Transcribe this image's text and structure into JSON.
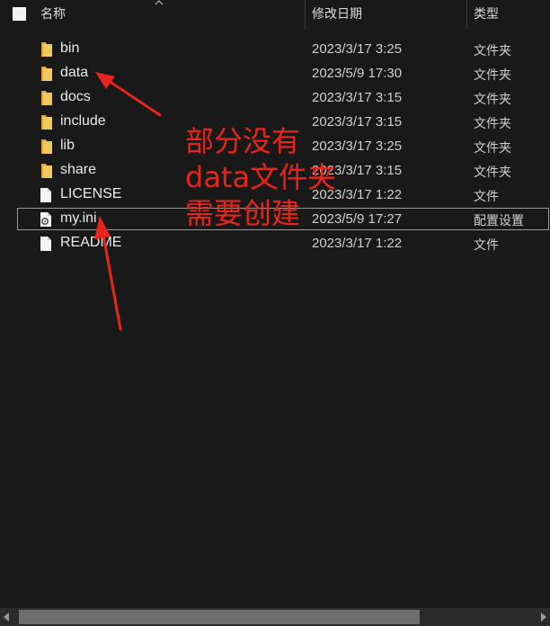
{
  "header": {
    "name_label": "名称",
    "date_label": "修改日期",
    "type_label": "类型"
  },
  "files": [
    {
      "name": "bin",
      "date": "2023/3/17 3:25",
      "type": "文件夹",
      "icon": "folder-icon"
    },
    {
      "name": "data",
      "date": "2023/5/9 17:30",
      "type": "文件夹",
      "icon": "folder-icon"
    },
    {
      "name": "docs",
      "date": "2023/3/17 3:15",
      "type": "文件夹",
      "icon": "folder-icon"
    },
    {
      "name": "include",
      "date": "2023/3/17 3:15",
      "type": "文件夹",
      "icon": "folder-icon"
    },
    {
      "name": "lib",
      "date": "2023/3/17 3:25",
      "type": "文件夹",
      "icon": "folder-icon"
    },
    {
      "name": "share",
      "date": "2023/3/17 3:15",
      "type": "文件夹",
      "icon": "folder-icon"
    },
    {
      "name": "LICENSE",
      "date": "2023/3/17 1:22",
      "type": "文件",
      "icon": "file-icon"
    },
    {
      "name": "my.ini",
      "date": "2023/5/9 17:27",
      "type": "配置设置",
      "icon": "settings-file-icon"
    },
    {
      "name": "README",
      "date": "2023/3/17 1:22",
      "type": "文件",
      "icon": "file-icon"
    }
  ],
  "annotation": {
    "line1": "部分没有",
    "line2": "data文件夹",
    "line3": "需要创建",
    "color": "#e8251c"
  },
  "colors": {
    "background": "#191919",
    "folder": "#f2c75c",
    "annotation": "#e8251c"
  }
}
